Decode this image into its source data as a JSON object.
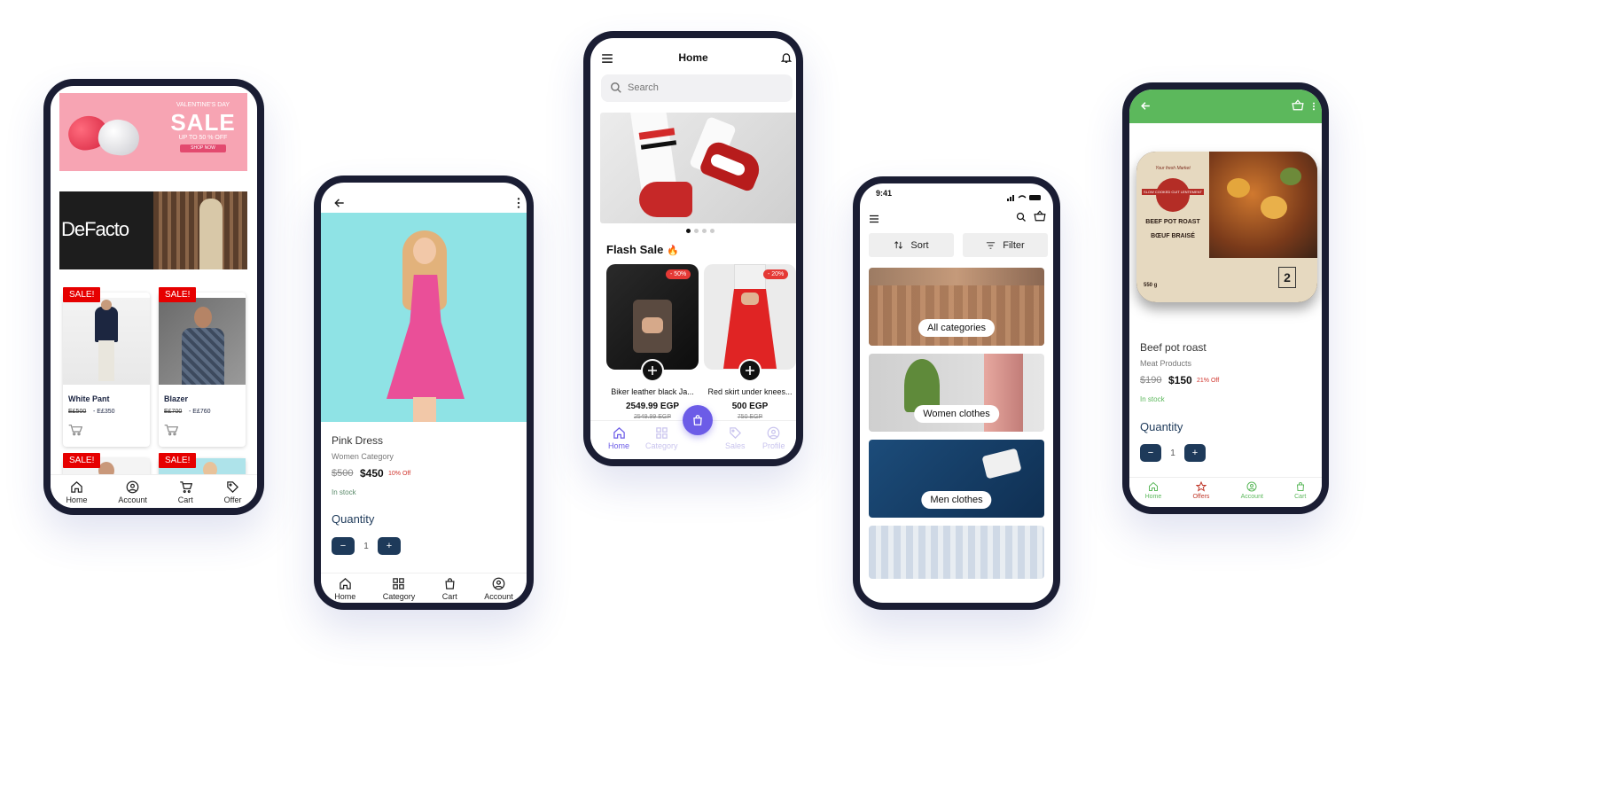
{
  "phone1": {
    "banner": {
      "title": "VALENTINE'S DAY",
      "sale": "SALE",
      "sub": "UP TO 50 % OFF",
      "cta": "SHOP NOW"
    },
    "brand_banner": {
      "text": "DeFacto"
    },
    "products": [
      {
        "badge": "SALE!",
        "name": "White Pant",
        "old_price": "E£500",
        "new_price": "- E£350"
      },
      {
        "badge": "SALE!",
        "name": "Blazer",
        "old_price": "E£700",
        "new_price": "- E£760"
      },
      {
        "badge": "SALE!"
      },
      {
        "badge": "SALE!"
      }
    ],
    "tabs": [
      {
        "label": "Home"
      },
      {
        "label": "Account"
      },
      {
        "label": "Cart"
      },
      {
        "label": "Offer"
      }
    ]
  },
  "phone2": {
    "product": {
      "name": "Pink Dress",
      "category": "Women Category",
      "old_price": "$500",
      "new_price": "$450",
      "discount": "10% Off",
      "stock": "In stock",
      "quantity_label": "Quantity",
      "quantity": "1",
      "minus": "−",
      "plus": "+"
    },
    "tabs": [
      {
        "label": "Home"
      },
      {
        "label": "Category"
      },
      {
        "label": "Cart"
      },
      {
        "label": "Account"
      }
    ]
  },
  "phone3": {
    "title": "Home",
    "search": {
      "placeholder": "Search"
    },
    "flash_title": "Flash Sale",
    "flash_emoji": "🔥",
    "items": [
      {
        "discount": "- 50%",
        "name": "Biker leather black Ja...",
        "price": "2549.99 EGP",
        "old_price": "2549.99 EGP"
      },
      {
        "discount": "- 20%",
        "name": "Red skirt under knees...",
        "price": "500 EGP",
        "old_price": "750 EGP"
      }
    ],
    "tabs": [
      {
        "label": "Home"
      },
      {
        "label": "Category"
      },
      {
        "label": "Sales"
      },
      {
        "label": "Profile"
      }
    ],
    "accent": "#6c5ce7"
  },
  "phone4": {
    "time": "9:41",
    "sort_label": "Sort",
    "filter_label": "Filter",
    "categories": [
      {
        "label": "All categories"
      },
      {
        "label": "Women clothes"
      },
      {
        "label": "Men clothes"
      }
    ]
  },
  "phone5": {
    "product": {
      "name": "Beef pot roast",
      "category": "Meat Products",
      "old_price": "$190",
      "new_price": "$150",
      "discount": "21% Off",
      "stock": "In stock",
      "quantity_label": "Quantity",
      "quantity": "1",
      "minus": "−",
      "plus": "+"
    },
    "package": {
      "brand": "Your fresh Market",
      "tag": "SLOW COOKED CUIT LENTEMENT",
      "name_en": "BEEF POT ROAST",
      "name_fr": "BŒUF BRAISÉ",
      "weight": "550 g",
      "serves": "2"
    },
    "tabs": [
      {
        "label": "Home"
      },
      {
        "label": "Offers"
      },
      {
        "label": "Account"
      },
      {
        "label": "Cart"
      }
    ],
    "accent": "#5cb85c",
    "offer_color": "#c0392b"
  }
}
